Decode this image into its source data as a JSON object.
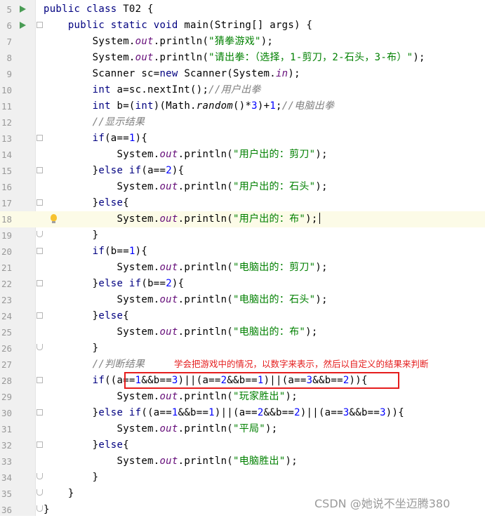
{
  "editor": {
    "lines": [
      {
        "number": "5",
        "tokens": [
          [
            "kw",
            "public class "
          ],
          [
            "p",
            "T02 {"
          ]
        ]
      },
      {
        "number": "6",
        "tokens": [
          [
            "p",
            "    "
          ],
          [
            "kw",
            "public static void "
          ],
          [
            "p",
            "main(String[] args) {"
          ]
        ]
      },
      {
        "number": "7",
        "tokens": [
          [
            "p",
            "        System."
          ],
          [
            "fld",
            "out"
          ],
          [
            "p",
            ".println("
          ],
          [
            "str",
            "\"猜拳游戏\""
          ],
          [
            "p",
            ");"
          ]
        ]
      },
      {
        "number": "8",
        "tokens": [
          [
            "p",
            "        System."
          ],
          [
            "fld",
            "out"
          ],
          [
            "p",
            ".println("
          ],
          [
            "str",
            "\"请出拳：（选择，1-剪刀，2-石头，3-布）\""
          ],
          [
            "p",
            ");"
          ]
        ]
      },
      {
        "number": "9",
        "tokens": [
          [
            "p",
            "        Scanner sc="
          ],
          [
            "kw",
            "new "
          ],
          [
            "p",
            "Scanner(System."
          ],
          [
            "fld",
            "in"
          ],
          [
            "p",
            ");"
          ]
        ]
      },
      {
        "number": "10",
        "tokens": [
          [
            "p",
            "        "
          ],
          [
            "kw",
            "int "
          ],
          [
            "p",
            "a=sc.nextInt();"
          ],
          [
            "cm",
            "//用户出拳"
          ]
        ]
      },
      {
        "number": "11",
        "tokens": [
          [
            "p",
            "        "
          ],
          [
            "kw",
            "int "
          ],
          [
            "p",
            "b=("
          ],
          [
            "kw",
            "int"
          ],
          [
            "p",
            ")(Math."
          ],
          [
            "sm",
            "random"
          ],
          [
            "p",
            "()*"
          ],
          [
            "num",
            "3"
          ],
          [
            "p",
            ")+"
          ],
          [
            "num",
            "1"
          ],
          [
            "p",
            ";"
          ],
          [
            "cm",
            "//电脑出拳"
          ]
        ]
      },
      {
        "number": "12",
        "tokens": [
          [
            "p",
            "        "
          ],
          [
            "cm",
            "//显示结果"
          ]
        ]
      },
      {
        "number": "13",
        "tokens": [
          [
            "p",
            "        "
          ],
          [
            "kw",
            "if"
          ],
          [
            "p",
            "(a=="
          ],
          [
            "num",
            "1"
          ],
          [
            "p",
            "){"
          ]
        ]
      },
      {
        "number": "14",
        "tokens": [
          [
            "p",
            "            System."
          ],
          [
            "fld",
            "out"
          ],
          [
            "p",
            ".println("
          ],
          [
            "str",
            "\"用户出的：剪刀\""
          ],
          [
            "p",
            ");"
          ]
        ]
      },
      {
        "number": "15",
        "tokens": [
          [
            "p",
            "        }"
          ],
          [
            "kw",
            "else if"
          ],
          [
            "p",
            "(a=="
          ],
          [
            "num",
            "2"
          ],
          [
            "p",
            "){"
          ]
        ]
      },
      {
        "number": "16",
        "tokens": [
          [
            "p",
            "            System."
          ],
          [
            "fld",
            "out"
          ],
          [
            "p",
            ".println("
          ],
          [
            "str",
            "\"用户出的：石头\""
          ],
          [
            "p",
            ");"
          ]
        ]
      },
      {
        "number": "17",
        "tokens": [
          [
            "p",
            "        }"
          ],
          [
            "kw",
            "else"
          ],
          [
            "p",
            "{"
          ]
        ]
      },
      {
        "number": "18",
        "tokens": [
          [
            "p",
            "            System."
          ],
          [
            "fld",
            "out"
          ],
          [
            "p",
            ".println("
          ],
          [
            "str",
            "\"用户出的：布\""
          ],
          [
            "p",
            ");"
          ]
        ]
      },
      {
        "number": "19",
        "tokens": [
          [
            "p",
            "        }"
          ]
        ]
      },
      {
        "number": "20",
        "tokens": [
          [
            "p",
            "        "
          ],
          [
            "kw",
            "if"
          ],
          [
            "p",
            "(b=="
          ],
          [
            "num",
            "1"
          ],
          [
            "p",
            "){"
          ]
        ]
      },
      {
        "number": "21",
        "tokens": [
          [
            "p",
            "            System."
          ],
          [
            "fld",
            "out"
          ],
          [
            "p",
            ".println("
          ],
          [
            "str",
            "\"电脑出的：剪刀\""
          ],
          [
            "p",
            ");"
          ]
        ]
      },
      {
        "number": "22",
        "tokens": [
          [
            "p",
            "        }"
          ],
          [
            "kw",
            "else if"
          ],
          [
            "p",
            "(b=="
          ],
          [
            "num",
            "2"
          ],
          [
            "p",
            "){"
          ]
        ]
      },
      {
        "number": "23",
        "tokens": [
          [
            "p",
            "            System."
          ],
          [
            "fld",
            "out"
          ],
          [
            "p",
            ".println("
          ],
          [
            "str",
            "\"电脑出的：石头\""
          ],
          [
            "p",
            ");"
          ]
        ]
      },
      {
        "number": "24",
        "tokens": [
          [
            "p",
            "        }"
          ],
          [
            "kw",
            "else"
          ],
          [
            "p",
            "{"
          ]
        ]
      },
      {
        "number": "25",
        "tokens": [
          [
            "p",
            "            System."
          ],
          [
            "fld",
            "out"
          ],
          [
            "p",
            ".println("
          ],
          [
            "str",
            "\"电脑出的：布\""
          ],
          [
            "p",
            ");"
          ]
        ]
      },
      {
        "number": "26",
        "tokens": [
          [
            "p",
            "        }"
          ]
        ]
      },
      {
        "number": "27",
        "tokens": [
          [
            "p",
            "        "
          ],
          [
            "cm",
            "//判断结果"
          ]
        ]
      },
      {
        "number": "28",
        "tokens": [
          [
            "p",
            "        "
          ],
          [
            "kw",
            "if"
          ],
          [
            "p",
            "(("
          ],
          [
            "p",
            "a=="
          ],
          [
            "num",
            "1"
          ],
          [
            "p",
            "&&b=="
          ],
          [
            "num",
            "3"
          ],
          [
            "p",
            ")||(a=="
          ],
          [
            "num",
            "2"
          ],
          [
            "p",
            "&&b=="
          ],
          [
            "num",
            "1"
          ],
          [
            "p",
            ")||(a=="
          ],
          [
            "num",
            "3"
          ],
          [
            "p",
            "&&b=="
          ],
          [
            "num",
            "2"
          ],
          [
            "p",
            "))"
          ],
          [
            "p",
            "{"
          ]
        ]
      },
      {
        "number": "29",
        "tokens": [
          [
            "p",
            "            System."
          ],
          [
            "fld",
            "out"
          ],
          [
            "p",
            ".println("
          ],
          [
            "str",
            "\"玩家胜出\""
          ],
          [
            "p",
            ");"
          ]
        ]
      },
      {
        "number": "30",
        "tokens": [
          [
            "p",
            "        }"
          ],
          [
            "kw",
            "else if"
          ],
          [
            "p",
            "((a=="
          ],
          [
            "num",
            "1"
          ],
          [
            "p",
            "&&b=="
          ],
          [
            "num",
            "1"
          ],
          [
            "p",
            ")||(a=="
          ],
          [
            "num",
            "2"
          ],
          [
            "p",
            "&&b=="
          ],
          [
            "num",
            "2"
          ],
          [
            "p",
            ")||(a=="
          ],
          [
            "num",
            "3"
          ],
          [
            "p",
            "&&b=="
          ],
          [
            "num",
            "3"
          ],
          [
            "p",
            "))"
          ],
          [
            "p",
            "{"
          ]
        ]
      },
      {
        "number": "31",
        "tokens": [
          [
            "p",
            "            System."
          ],
          [
            "fld",
            "out"
          ],
          [
            "p",
            ".println("
          ],
          [
            "str",
            "\"平局\""
          ],
          [
            "p",
            ");"
          ]
        ]
      },
      {
        "number": "32",
        "tokens": [
          [
            "p",
            "        }"
          ],
          [
            "kw",
            "else"
          ],
          [
            "p",
            "{"
          ]
        ]
      },
      {
        "number": "33",
        "tokens": [
          [
            "p",
            "            System."
          ],
          [
            "fld",
            "out"
          ],
          [
            "p",
            ".println("
          ],
          [
            "str",
            "\"电脑胜出\""
          ],
          [
            "p",
            ");"
          ]
        ]
      },
      {
        "number": "34",
        "tokens": [
          [
            "p",
            "        }"
          ]
        ]
      },
      {
        "number": "35",
        "tokens": [
          [
            "p",
            "    }"
          ]
        ]
      },
      {
        "number": "36",
        "tokens": [
          [
            "p",
            "}"
          ]
        ]
      }
    ],
    "run_icon_lines": [
      "5",
      "6"
    ],
    "fold_start_lines": [
      "6",
      "13",
      "15",
      "17",
      "20",
      "22",
      "24",
      "28",
      "30",
      "32"
    ],
    "fold_end_lines": [
      "19",
      "26",
      "34",
      "35",
      "36"
    ],
    "intention_bulb_line": "18",
    "caret_line": "18"
  },
  "annotation": {
    "text": "学会把游戏中的情况，以数字来表示，然后以自定义的结果来判断",
    "color": "#e51d1d"
  },
  "watermark": {
    "text": "CSDN @她说不坐迈腾380"
  },
  "colors": {
    "keyword": "#000080",
    "number": "#0000ff",
    "string": "#008000",
    "field": "#660e7a",
    "comment": "#808080",
    "gutter": "#f0f0f0",
    "caret_line": "#fcfbe7",
    "run_icon": "#499c54"
  },
  "icons": {
    "run": "run-gutter-icon",
    "fold": "fold-marker-icon",
    "bulb": "intention-bulb-icon"
  }
}
